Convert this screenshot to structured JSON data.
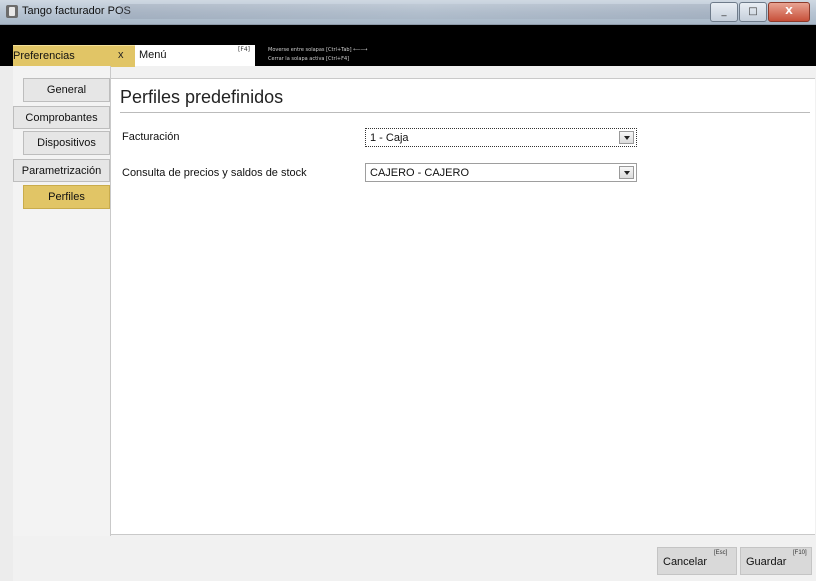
{
  "window": {
    "title": "Tango facturador POS",
    "minimize_glyph": "_",
    "maximize_glyph": "□",
    "close_glyph": "X"
  },
  "tabs": {
    "active_tab": {
      "label": "Preferencias",
      "close_glyph": "x"
    },
    "menu_tab": {
      "label": "Menú",
      "shortcut": "[F4]"
    },
    "hints": [
      "Moverse entre solapas [Ctrl+Tab] ⟵⟶",
      "Cerrar la solapa activa [Ctrl+F4]"
    ]
  },
  "sidebar": {
    "items": [
      {
        "label": "General",
        "active": false
      },
      {
        "label": "Comprobantes",
        "active": false
      },
      {
        "label": "Dispositivos",
        "active": false
      },
      {
        "label": "Parametrización",
        "active": false
      },
      {
        "label": "Perfiles",
        "active": true
      }
    ]
  },
  "main": {
    "title": "Perfiles predefinidos",
    "fields": [
      {
        "label": "Facturación",
        "value": "1 - Caja"
      },
      {
        "label": "Consulta de precios y saldos de stock",
        "value": "CAJERO - CAJERO"
      }
    ]
  },
  "footer": {
    "cancel": {
      "label": "Cancelar",
      "shortcut": "[Esc]"
    },
    "save": {
      "label": "Guardar",
      "shortcut": "[F10]"
    }
  },
  "colors": {
    "accent": "#e1c566",
    "tabstrip": "#000000"
  }
}
